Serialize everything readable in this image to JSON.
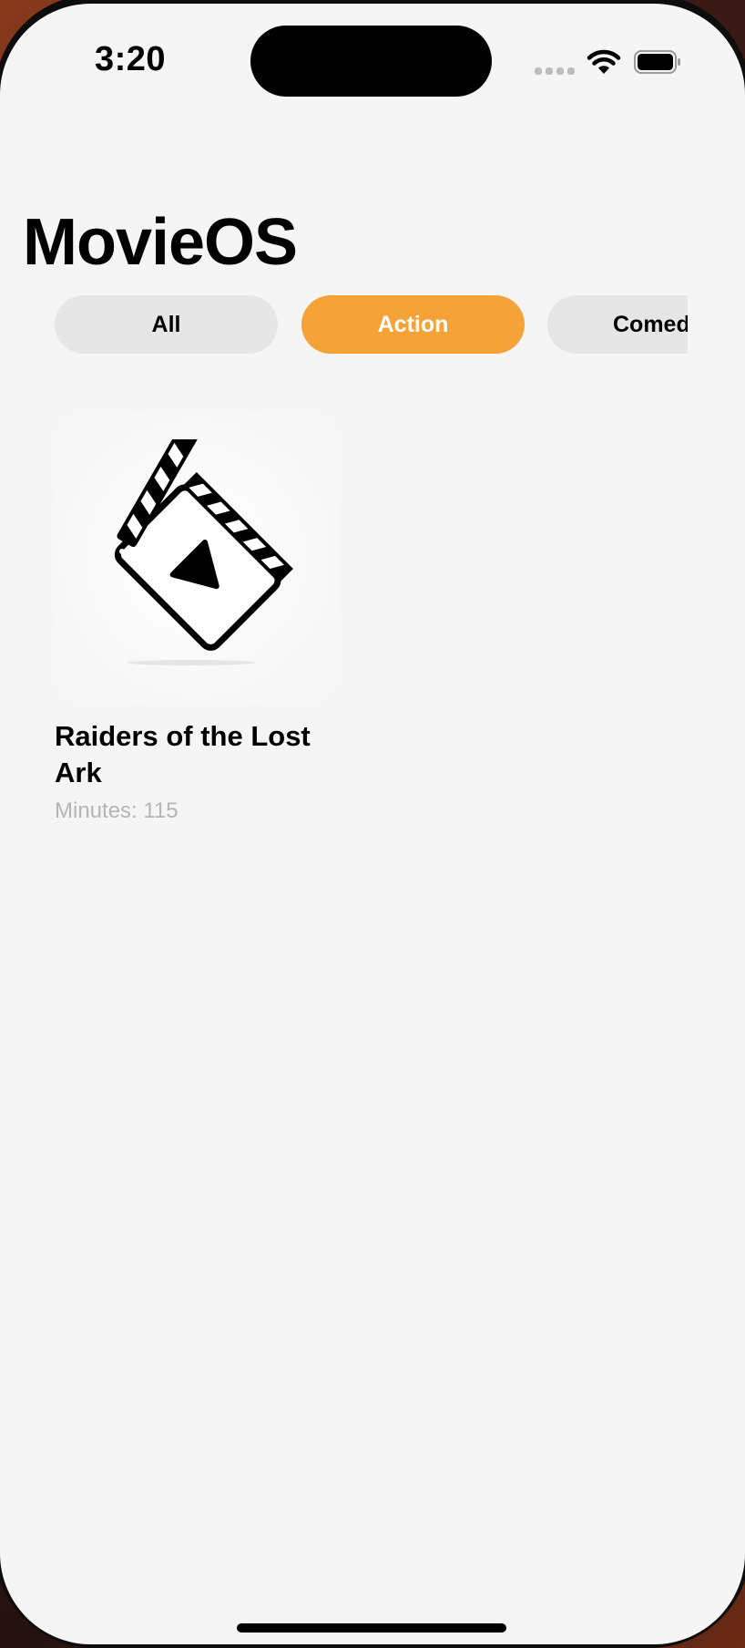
{
  "status_bar": {
    "time": "3:20",
    "signal_icon": "cellular-signal-icon",
    "wifi_icon": "wifi-icon",
    "battery_icon": "battery-icon"
  },
  "header": {
    "title": "MovieOS"
  },
  "categories": {
    "items": [
      {
        "label": "All",
        "selected": false
      },
      {
        "label": "Action",
        "selected": true
      },
      {
        "label": "Comedy",
        "selected": false
      }
    ],
    "active_color": "#f5a339",
    "inactive_color": "#e6e6e6"
  },
  "movies": [
    {
      "title": "Raiders of the Lost Ark",
      "minutes_text": "Minutes: 115",
      "poster_icon": "clapperboard-icon"
    }
  ]
}
